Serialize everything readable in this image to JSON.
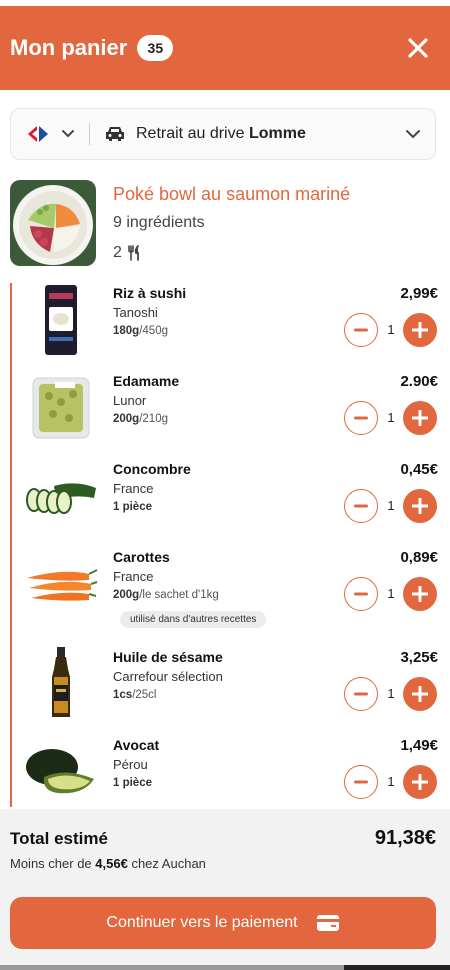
{
  "header": {
    "title": "Mon panier",
    "count": "35"
  },
  "store": {
    "drive_prefix": "Retrait au drive",
    "drive_location": "Lomme"
  },
  "recipe": {
    "name": "Poké bowl au saumon mariné",
    "ingredients": "9 ingrédients",
    "servings": "2"
  },
  "items": [
    {
      "name": "Riz à sushi",
      "origin": "Tanoshi",
      "qty_bold": "180g",
      "qty_rest": "/450g",
      "price": "2,99€",
      "count": "1"
    },
    {
      "name": "Edamame",
      "origin": "Lunor",
      "qty_bold": "200g",
      "qty_rest": "/210g",
      "price": "2.90€",
      "count": "1"
    },
    {
      "name": "Concombre",
      "origin": "France",
      "qty_bold": "1 pièce",
      "qty_rest": "",
      "price": "0,45€",
      "count": "1"
    },
    {
      "name": "Carottes",
      "origin": "France",
      "qty_bold": "200g",
      "qty_rest": "/le sachet d'1kg",
      "price": "0,89€",
      "count": "1",
      "tag": "utilisé dans d'autres recettes"
    },
    {
      "name": "Huile de sésame",
      "origin": "Carrefour sélection",
      "qty_bold": "1cs",
      "qty_rest": "/25cl",
      "price": "3,25€",
      "count": "1"
    },
    {
      "name": "Avocat",
      "origin": "Pérou",
      "qty_bold": "1 pièce",
      "qty_rest": "",
      "price": "1,49€",
      "count": "1"
    }
  ],
  "footer": {
    "total_label": "Total estimé",
    "total_value": "91,38€",
    "cheaper_prefix": "Moins cher de",
    "cheaper_amount": "4,56€",
    "cheaper_suffix": "chez Auchan",
    "pay_label": "Continuer vers le paiement"
  },
  "colors": {
    "accent": "#e2673f",
    "footer_bg": "#f2f2f2"
  },
  "icons": {
    "close": "close-icon",
    "brand": "carrefour-logo-icon",
    "car": "car-icon",
    "chevron": "chevron-down-icon",
    "utensils": "utensils-icon",
    "minus": "minus-icon",
    "plus": "plus-icon",
    "card": "credit-card-icon"
  }
}
